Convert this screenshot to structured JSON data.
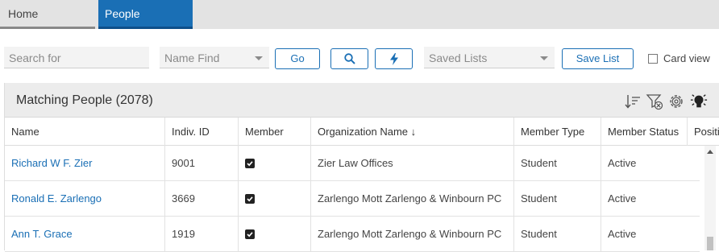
{
  "tabs": {
    "home": "Home",
    "people": "People"
  },
  "toolbar": {
    "search_placeholder": "Search for",
    "name_find": "Name Find",
    "go_label": "Go",
    "saved_lists": "Saved Lists",
    "save_list_label": "Save List",
    "card_view_label": "Card view"
  },
  "panel": {
    "title": "Matching People (2078)",
    "header_icons": [
      "sort-icon",
      "filter-clear-icon",
      "settings-icon",
      "lightbulb-icon"
    ]
  },
  "columns": {
    "name": "Name",
    "indiv_id": "Indiv. ID",
    "member": "Member",
    "org": "Organization Name ↓",
    "member_type": "Member Type",
    "member_status": "Member Status",
    "position": "Positi"
  },
  "rows": [
    {
      "name": "Richard W F. Zier",
      "id": "9001",
      "member": true,
      "org": "Zier Law Offices",
      "type": "Student",
      "status": "Active"
    },
    {
      "name": "Ronald E. Zarlengo",
      "id": "3669",
      "member": true,
      "org": "Zarlengo Mott Zarlengo & Winbourn PC",
      "type": "Student",
      "status": "Active"
    },
    {
      "name": "Ann T. Grace",
      "id": "1919",
      "member": true,
      "org": "Zarlengo Mott Zarlengo & Winbourn PC",
      "type": "Student",
      "status": "Active"
    }
  ],
  "colors": {
    "accent": "#1a6fb5"
  }
}
